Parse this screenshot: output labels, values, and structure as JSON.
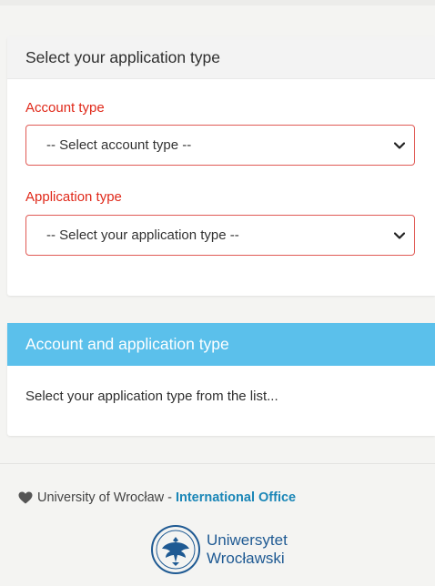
{
  "card_select": {
    "title": "Select your application type",
    "account_type": {
      "label": "Account type",
      "selected": "-- Select account type --"
    },
    "application_type": {
      "label": "Application type",
      "selected": "-- Select your application type --"
    }
  },
  "card_info": {
    "title": "Account and application type",
    "body": "Select your application type from the list..."
  },
  "footer": {
    "university": "University of Wrocław",
    "separator": "-",
    "link": "International Office"
  },
  "logo": {
    "line1": "Uniwersytet",
    "line2": "Wrocławski"
  },
  "colors": {
    "required_label": "#e0291a",
    "info_header": "#5bc0eb",
    "link": "#1a86b7",
    "logo": "#1f5a93"
  }
}
